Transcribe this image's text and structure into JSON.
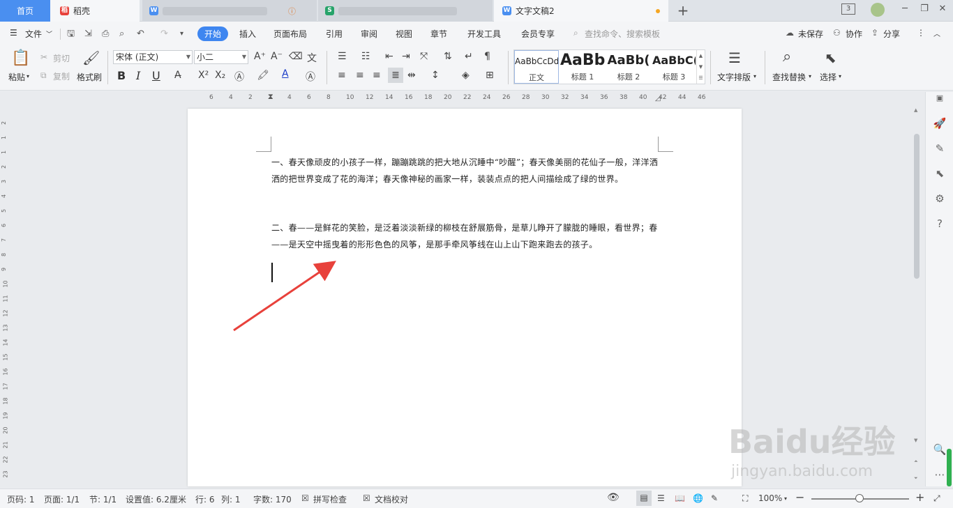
{
  "tabs": {
    "home": "首页",
    "daoke": "稻壳",
    "doc": "文字文稿2"
  },
  "menu": {
    "file": "文件",
    "items": [
      "开始",
      "插入",
      "页面布局",
      "引用",
      "审阅",
      "视图",
      "章节",
      "开发工具",
      "会员专享"
    ],
    "search_placeholder": "查找命令、搜索模板",
    "unsaved": "未保存",
    "collab": "协作",
    "share": "分享"
  },
  "ribbon": {
    "paste": "粘贴",
    "cut": "剪切",
    "copy": "复制",
    "format_painter": "格式刷",
    "font_name": "宋体 (正文)",
    "font_size": "小二",
    "bold": "B",
    "italic": "I",
    "underline": "U",
    "styles": [
      {
        "sample": "AaBbCcDd",
        "label": "正文"
      },
      {
        "sample": "AaBb",
        "label": "标题 1"
      },
      {
        "sample": "AaBb(",
        "label": "标题 2"
      },
      {
        "sample": "AaBbC(",
        "label": "标题 3"
      }
    ],
    "text_layout": "文字排版",
    "find_replace": "查找替换",
    "select": "选择"
  },
  "ruler": {
    "h_ticks": [
      "6",
      "4",
      "2",
      "2",
      "4",
      "6",
      "8",
      "10",
      "12",
      "14",
      "16",
      "18",
      "20",
      "22",
      "24",
      "26",
      "28",
      "30",
      "32",
      "34",
      "36",
      "38",
      "40",
      "42",
      "44",
      "46"
    ],
    "v_ticks": [
      "2",
      "1",
      "1",
      "2",
      "3",
      "4",
      "5",
      "6",
      "7",
      "8",
      "9",
      "10",
      "11",
      "12",
      "13",
      "14",
      "15",
      "16",
      "17",
      "18",
      "19",
      "20",
      "21",
      "22",
      "23"
    ]
  },
  "document": {
    "para1": "一、春天像顽皮的小孩子一样，蹦蹦跳跳的把大地从沉睡中“吵醒”；春天像美丽的花仙子一般，洋洋洒洒的把世界变成了花的海洋；春天像神秘的画家一样，装装点点的把人间描绘成了绿的世界。",
    "para2": "二、春——是鲜花的笑脸，是泛着淡淡新绿的柳枝在舒展筋骨，是草儿睁开了朦胧的睡眼，看世界；春——是天空中摇曳着的形形色色的风筝，是那手牵风筝线在山上山下跑来跑去的孩子。"
  },
  "status": {
    "page_code": "页码: 1",
    "page": "页面: 1/1",
    "section": "节: 1/1",
    "setting": "设置值: 6.2厘米",
    "row": "行: 6",
    "col": "列: 1",
    "word_count": "字数: 170",
    "spell_check": "拼写检查",
    "doc_proof": "文档校对",
    "zoom": "100%"
  },
  "watermark": {
    "brand": "Baidu经验",
    "url": "jingyan.baidu.com"
  },
  "colors": {
    "accent": "#3e86f0",
    "arrow": "#e8413b"
  }
}
